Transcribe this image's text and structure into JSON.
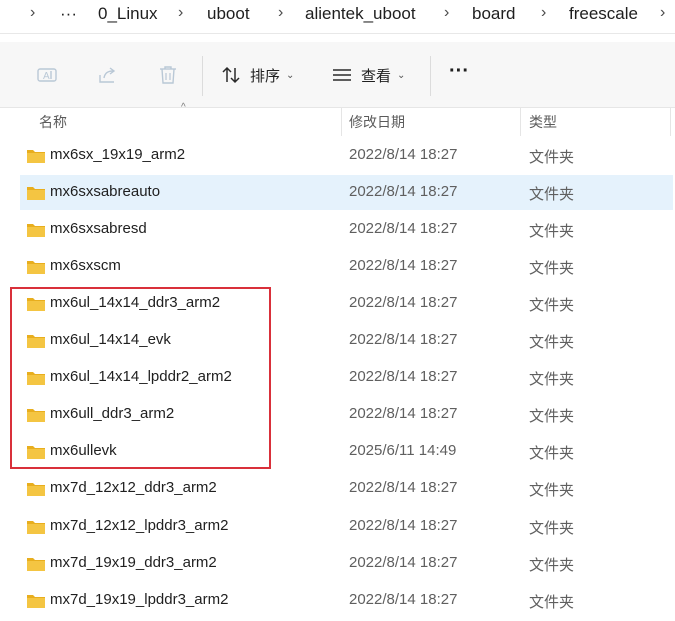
{
  "breadcrumb": {
    "items": [
      "0_Linux",
      "uboot",
      "alientek_uboot",
      "board",
      "freescale"
    ],
    "overflow_label": "···",
    "separator": "›"
  },
  "toolbar": {
    "rename_icon": "rename-icon",
    "share_icon": "share-icon",
    "delete_icon": "delete-icon",
    "sort_label": "排序",
    "view_label": "查看",
    "more_label": "···"
  },
  "columns": {
    "name": "名称",
    "modified": "修改日期",
    "type": "类型"
  },
  "files": [
    {
      "name": "mx6sx_19x19_arm2",
      "date": "2022/8/14 18:27",
      "type": "文件夹"
    },
    {
      "name": "mx6sxsabreauto",
      "date": "2022/8/14 18:27",
      "type": "文件夹"
    },
    {
      "name": "mx6sxsabresd",
      "date": "2022/8/14 18:27",
      "type": "文件夹"
    },
    {
      "name": "mx6sxscm",
      "date": "2022/8/14 18:27",
      "type": "文件夹"
    },
    {
      "name": "mx6ul_14x14_ddr3_arm2",
      "date": "2022/8/14 18:27",
      "type": "文件夹"
    },
    {
      "name": "mx6ul_14x14_evk",
      "date": "2022/8/14 18:27",
      "type": "文件夹"
    },
    {
      "name": "mx6ul_14x14_lpddr2_arm2",
      "date": "2022/8/14 18:27",
      "type": "文件夹"
    },
    {
      "name": "mx6ull_ddr3_arm2",
      "date": "2022/8/14 18:27",
      "type": "文件夹"
    },
    {
      "name": "mx6ullevk",
      "date": "2025/6/11 14:49",
      "type": "文件夹"
    },
    {
      "name": "mx7d_12x12_ddr3_arm2",
      "date": "2022/8/14 18:27",
      "type": "文件夹"
    },
    {
      "name": "mx7d_12x12_lpddr3_arm2",
      "date": "2022/8/14 18:27",
      "type": "文件夹"
    },
    {
      "name": "mx7d_19x19_ddr3_arm2",
      "date": "2022/8/14 18:27",
      "type": "文件夹"
    },
    {
      "name": "mx7d_19x19_lpddr3_arm2",
      "date": "2022/8/14 18:27",
      "type": "文件夹"
    }
  ],
  "selected_index": 1,
  "colors": {
    "folder": "#f4c542",
    "selection": "#e5f2fc",
    "highlight": "#d9303a"
  }
}
